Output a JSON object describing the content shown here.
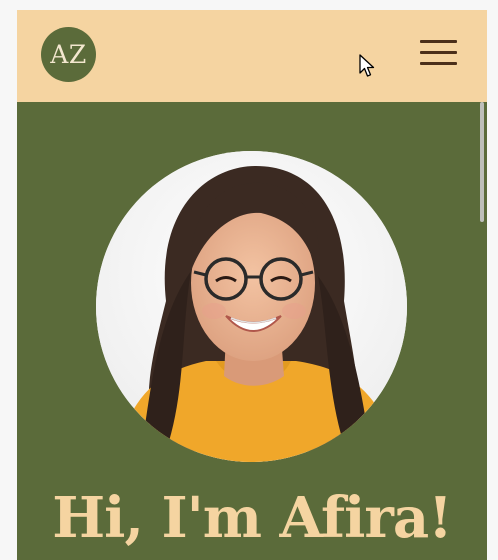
{
  "header": {
    "logo_text": "AZ",
    "menu_icon": "hamburger-menu-icon",
    "cursor_icon": "mouse-pointer-icon"
  },
  "hero": {
    "portrait_alt": "portrait photo",
    "headline": "Hi, I'm Afira!"
  },
  "colors": {
    "header_bg": "#f5d4a1",
    "page_bg": "#5b6b3a",
    "accent_text": "#f5d4a1",
    "menu_lines": "#4b2f1a"
  }
}
